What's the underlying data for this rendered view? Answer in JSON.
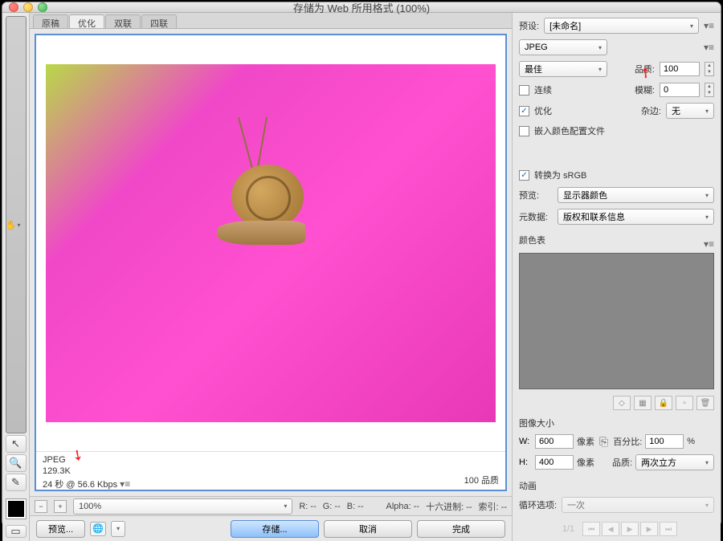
{
  "window": {
    "title": "存储为 Web 所用格式 (100%)"
  },
  "tabs": {
    "original": "原稿",
    "optimized": "优化",
    "two_up": "双联",
    "four_up": "四联"
  },
  "preview": {
    "format": "JPEG",
    "filesize": "129.3K",
    "loadtime": "24 秒 @ 56.6 Kbps",
    "quality_readout": "100 品质"
  },
  "bottombar": {
    "zoom": "100%",
    "r": "R: --",
    "g": "G: --",
    "b": "B: --",
    "alpha": "Alpha: --",
    "hex": "十六进制: --",
    "index": "索引: --"
  },
  "footer": {
    "preview": "预览...",
    "save": "存储...",
    "cancel": "取消",
    "done": "完成"
  },
  "right": {
    "preset_lbl": "预设:",
    "preset_val": "[未命名]",
    "format": "JPEG",
    "quality_mode": "最佳",
    "quality_lbl": "品质:",
    "quality_val": "100",
    "progressive": "连续",
    "blur_lbl": "模糊:",
    "blur_val": "0",
    "optimized": "优化",
    "matte_lbl": "杂边:",
    "matte_val": "无",
    "embed_profile": "嵌入颜色配置文件",
    "convert_srgb": "转换为 sRGB",
    "preview_lbl": "预览:",
    "preview_val": "显示器颜色",
    "metadata_lbl": "元数据:",
    "metadata_val": "版权和联系信息",
    "color_table": "颜色表",
    "image_size": "图像大小",
    "w_lbl": "W:",
    "w_val": "600",
    "h_lbl": "H:",
    "h_val": "400",
    "px": "像素",
    "percent_lbl": "百分比:",
    "percent_val": "100",
    "percent_suffix": "%",
    "resample_lbl": "品质:",
    "resample_val": "两次立方",
    "anim": "动画",
    "loop_lbl": "循环选项:",
    "loop_val": "一次",
    "frame": "1/1"
  }
}
